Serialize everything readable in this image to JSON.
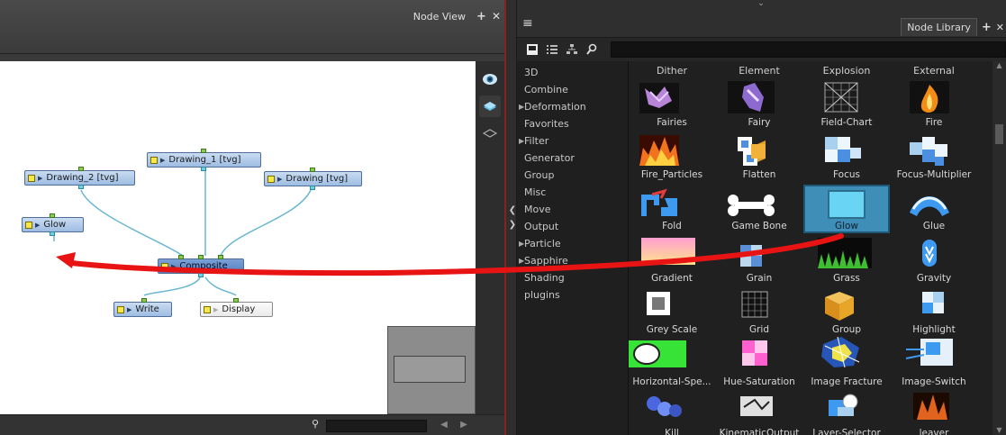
{
  "node_view": {
    "title": "Node View",
    "nodes": {
      "drawing_2": "Drawing_2 [tvg]",
      "drawing_1": "Drawing_1 [tvg]",
      "drawing": "Drawing [tvg]",
      "glow": "Glow",
      "composite": "Composite",
      "write": "Write",
      "display": "Display"
    }
  },
  "node_library": {
    "title": "Node Library",
    "categories": [
      "3D",
      "Combine",
      "Deformation",
      "Favorites",
      "Filter",
      "Generator",
      "Group",
      "Misc",
      "Move",
      "Output",
      "Particle",
      "Sapphire",
      "Shading",
      "plugins"
    ],
    "column_headers": [
      "Dither",
      "Element",
      "Explosion",
      "External"
    ],
    "tiles": [
      "Fairies",
      "Fairy",
      "Field-Chart",
      "Fire",
      "Fire_Particles",
      "Flatten",
      "Focus",
      "Focus-Multiplier",
      "Fold",
      "Game Bone",
      "Glow",
      "Glue",
      "Gradient",
      "Grain",
      "Grass",
      "Gravity",
      "Grey Scale",
      "Grid",
      "Group",
      "Highlight",
      "Horizontal-Spe...",
      "Hue-Saturation",
      "Image Fracture",
      "Image-Switch",
      "Kill",
      "KinematicOutput",
      "Layer-Selector",
      "leaver"
    ]
  },
  "colors": {
    "annotation_arrow": "#e81414",
    "selected_tile": "#3f8eb8",
    "node_blue": "#9ebde2"
  }
}
